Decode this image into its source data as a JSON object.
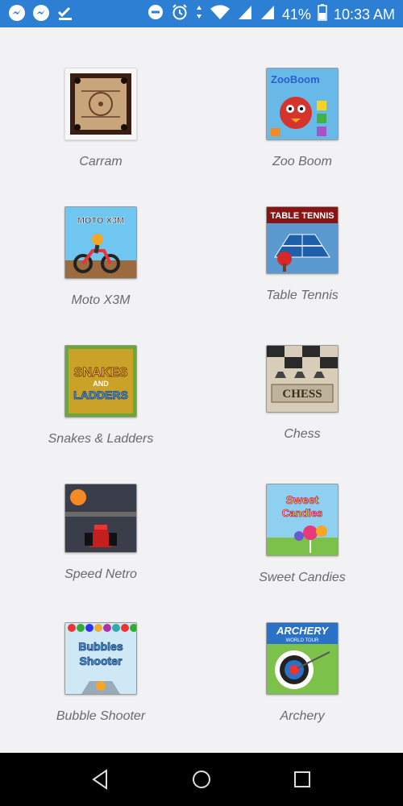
{
  "status_bar": {
    "battery_percent": "41%",
    "time": "10:33 AM",
    "icons": [
      "messenger-icon",
      "messenger-icon",
      "check-icon",
      "do-not-disturb-icon",
      "alarm-icon",
      "data-arrows-icon",
      "wifi-icon",
      "signal-icon",
      "signal-icon",
      "battery-icon"
    ]
  },
  "games": [
    {
      "title": "Carram",
      "icon": "carrom-board-icon"
    },
    {
      "title": "Zoo Boom",
      "icon": "zoo-boom-icon"
    },
    {
      "title": "Moto X3M",
      "icon": "moto-x3m-icon"
    },
    {
      "title": "Table Tennis",
      "icon": "table-tennis-icon"
    },
    {
      "title": "Snakes & Ladders",
      "icon": "snakes-ladders-icon"
    },
    {
      "title": "Chess",
      "icon": "chess-icon"
    },
    {
      "title": "Speed Netro",
      "icon": "speed-netro-icon"
    },
    {
      "title": "Sweet Candies",
      "icon": "sweet-candies-icon"
    },
    {
      "title": "Bubble Shooter",
      "icon": "bubble-shooter-icon"
    },
    {
      "title": "Archery",
      "icon": "archery-icon"
    }
  ],
  "thumb_text": {
    "zoo": "ZooBoom",
    "moto": "MOTO X3M",
    "table_tennis": "TABLE TENNIS",
    "snakes1": "SNAKES",
    "snakes2": "AND",
    "snakes3": "LADDERS",
    "chess": "CHESS",
    "sweet1": "Sweet",
    "sweet2": "Candies",
    "bubbles1": "Bubbles",
    "bubbles2": "Shooter",
    "archery1": "ARCHERY",
    "archery2": "WORLD TOUR"
  },
  "colors": {
    "status_bar": "#2d7fd3",
    "label_text": "#6a6a6a",
    "background": "#f2f2f4"
  },
  "nav": {
    "back": "back-icon",
    "home": "home-icon",
    "recents": "recents-icon"
  }
}
